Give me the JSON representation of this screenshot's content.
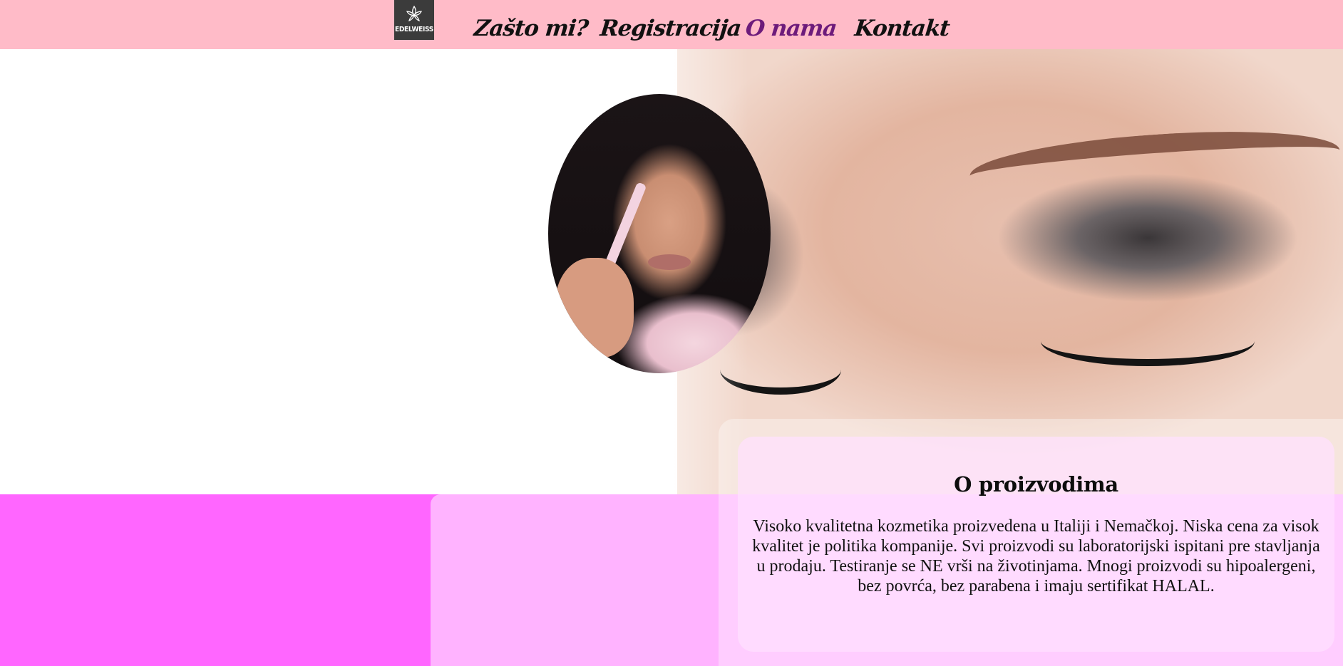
{
  "brand": {
    "logo_text": "EDELWEISS",
    "logo_icon": "lotus-flower-icon"
  },
  "nav": {
    "items": [
      {
        "label": "Zašto mi?"
      },
      {
        "label": "Registracija"
      },
      {
        "label": "O nama",
        "active": true
      },
      {
        "label": "Kontakt"
      }
    ]
  },
  "hero": {
    "images": [
      "eye-makeup-photo",
      "model-portrait-photo"
    ]
  },
  "info": {
    "title": "O proizvodima",
    "text": "Visoko kvalitetna kozmetika proizvedena u Italiji i Nemačkoj. Niska cena za visok kvalitet je politika kompanije. Svi proizvodi su laboratorijski ispitani pre stavljanja u prodaju. Testiranje se NE vrši na životinjama. Mnogi proizvodi su hipoalergeni, bez povrća, bez parabena i imaju sertifikat HALAL."
  },
  "colors": {
    "nav_bg": "#ffbbc8",
    "nav_active": "#6d1b7b",
    "band_magenta": "#ff66ff",
    "band_light": "#ffb3ff"
  }
}
